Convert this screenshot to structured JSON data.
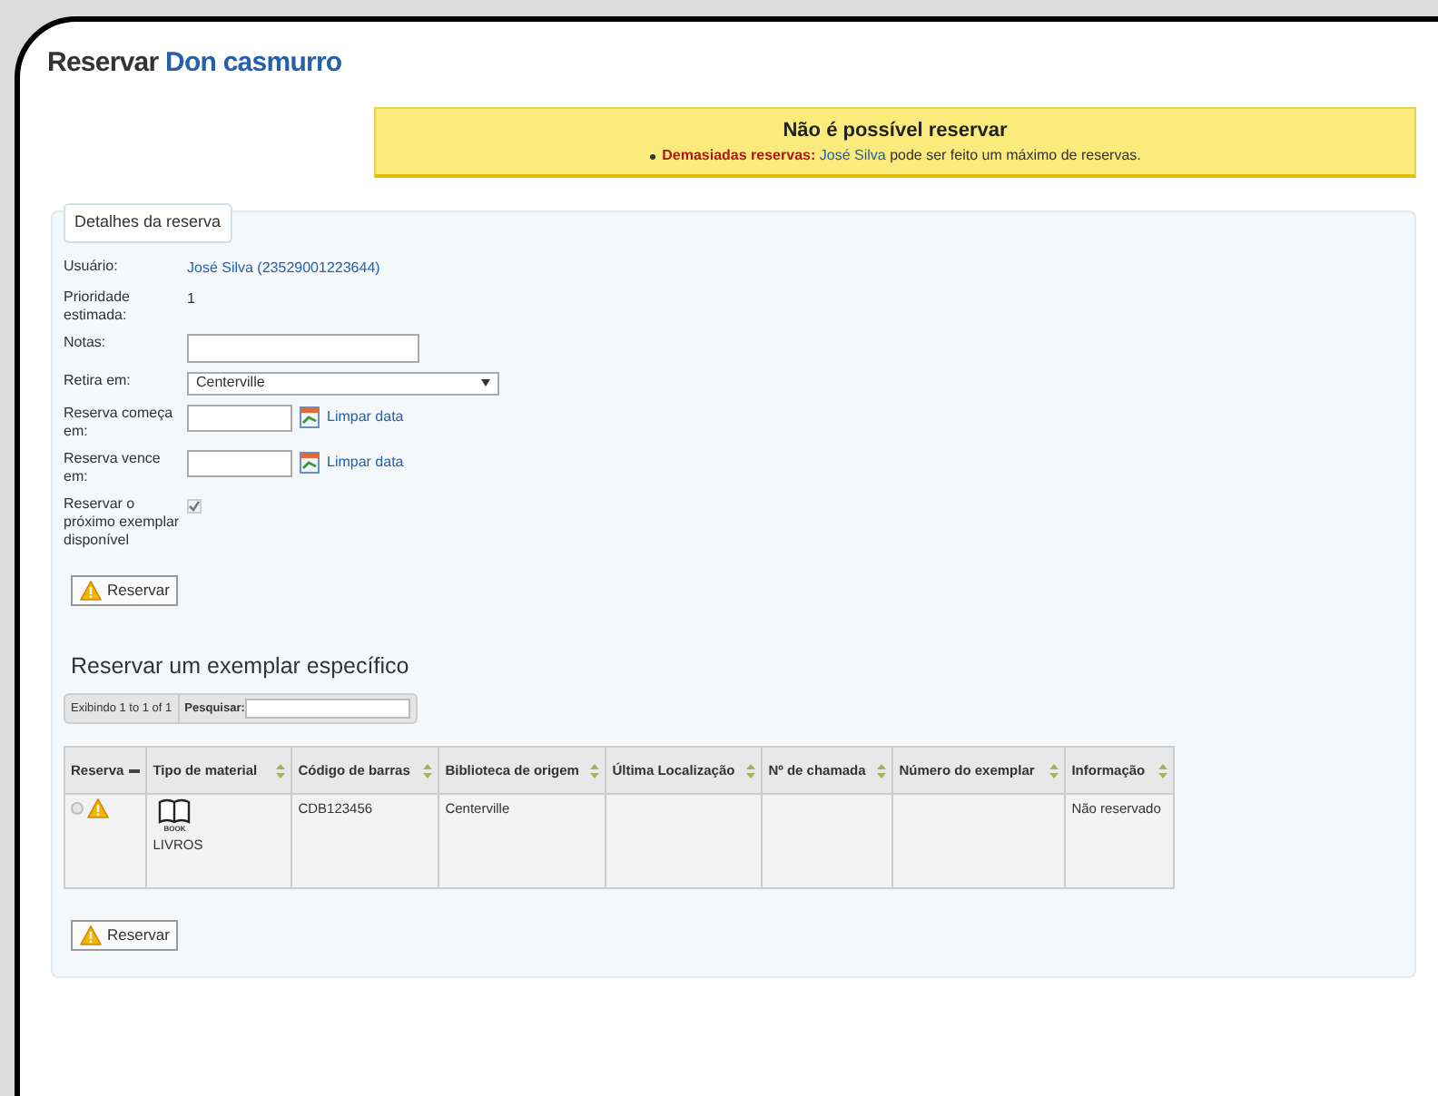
{
  "title": {
    "prefix": "Reservar",
    "link": "Don casmurro"
  },
  "alert": {
    "heading": "Não é possível reservar",
    "items": [
      {
        "label": "Demasiadas reservas:",
        "patron": "José Silva",
        "text": "pode ser feito um máximo de reservas."
      }
    ]
  },
  "details": {
    "legend": "Detalhes da reserva",
    "fields": [
      {
        "kind": "link",
        "label": "Usuário:",
        "value": "José Silva (23529001223644)"
      },
      {
        "kind": "text",
        "label": "Prioridade estimada:",
        "value": "1"
      },
      {
        "kind": "textarea",
        "label": "Notas:"
      },
      {
        "kind": "select",
        "label": "Retira em:",
        "value": "Centerville"
      },
      {
        "kind": "date",
        "label": "Reserva começa em:",
        "action": "Limpar data"
      },
      {
        "kind": "date",
        "label": "Reserva vence em:",
        "action": "Limpar data"
      },
      {
        "kind": "checkbox",
        "label": "Reservar o próximo exemplar disponível",
        "checked": true
      }
    ],
    "button": "Reservar"
  },
  "specific": {
    "heading": "Reservar um exemplar específico",
    "info": "Exibindo 1 to 1 of 1",
    "search_label": "Pesquisar:",
    "columns": [
      {
        "label": "Reserva",
        "sorted": true
      },
      {
        "label": "Tipo de material",
        "sorted": false
      },
      {
        "label": "Código de barras",
        "sorted": false
      },
      {
        "label": "Biblioteca de origem",
        "sorted": false
      },
      {
        "label": "Última Localização",
        "sorted": false
      },
      {
        "label": "Nº de chamada",
        "sorted": false
      },
      {
        "label": "Número do exemplar",
        "sorted": false
      },
      {
        "label": "Informação",
        "sorted": false
      }
    ],
    "rows": [
      {
        "selected": false,
        "icon_caption": "BOOK",
        "material": "LIVROS",
        "barcode": "CDB123456",
        "library": "Centerville",
        "location": "",
        "callnumber": "",
        "copynumber": "",
        "info": "Não reservado"
      }
    ],
    "button": "Reservar"
  }
}
